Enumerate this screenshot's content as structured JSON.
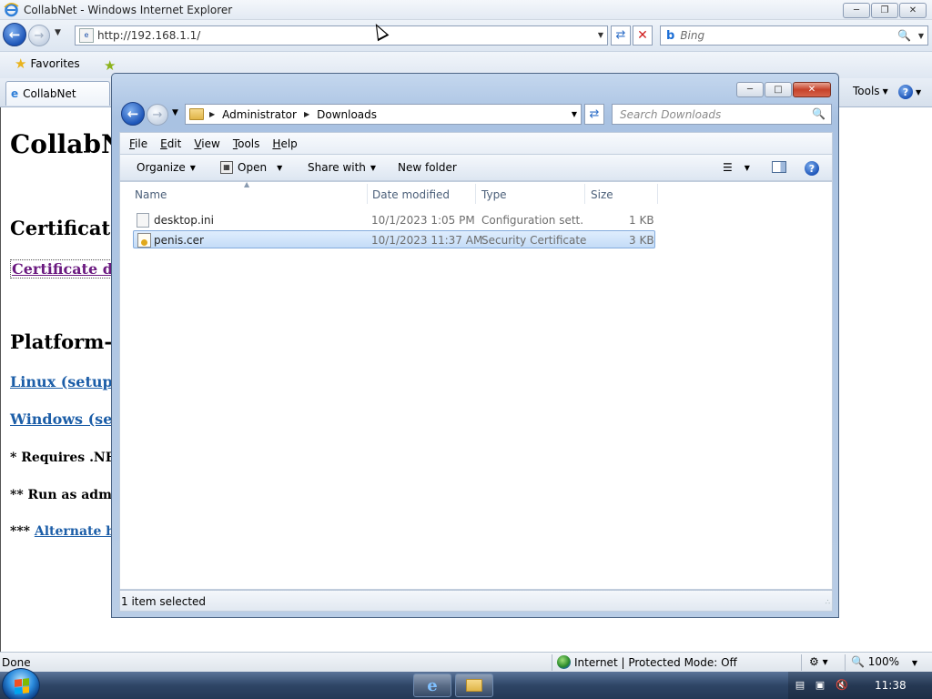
{
  "ie": {
    "title": "CollabNet - Windows Internet Explorer",
    "url": "http://192.168.1.1/",
    "search_placeholder": "Bing",
    "favorites_label": "Favorites",
    "tab_label": "CollabNet",
    "tools_label": "Tools",
    "status_left": "Done",
    "zone_text": "Internet | Protected Mode: Off",
    "zoom_text": "100%",
    "content": {
      "heading": "CollabN",
      "cert_heading": "Certificate",
      "cert_link": "Certificate do",
      "platform_heading": "Platform-sp",
      "linux_link": "Linux (setupc",
      "windows_link": "Windows (set",
      "note1": "* Requires .NET",
      "note2": "** Run as admin",
      "note3_prefix": "*** ",
      "note3_link": "Alternate bu"
    }
  },
  "explorer": {
    "breadcrumb": [
      "Administrator",
      "Downloads"
    ],
    "search_placeholder": "Search Downloads",
    "menu": [
      "File",
      "Edit",
      "View",
      "Tools",
      "Help"
    ],
    "toolbar": {
      "organize": "Organize",
      "open": "Open",
      "share_with": "Share with",
      "new_folder": "New folder"
    },
    "columns": {
      "name": "Name",
      "date": "Date modified",
      "type": "Type",
      "size": "Size"
    },
    "files": [
      {
        "name": "desktop.ini",
        "date": "10/1/2023 1:05 PM",
        "type": "Configuration sett...",
        "size": "1 KB",
        "icon": "ini-file-icon"
      },
      {
        "name": "penis.cer",
        "date": "10/1/2023 11:37 AM",
        "type": "Security Certificate",
        "size": "3 KB",
        "icon": "certificate-file-icon"
      }
    ],
    "status": "1 item selected"
  },
  "taskbar": {
    "clock": "11:38"
  },
  "colors": {
    "selection": "#c4dcf7",
    "link": "#1c5ea8",
    "visited": "#6b1a80"
  }
}
